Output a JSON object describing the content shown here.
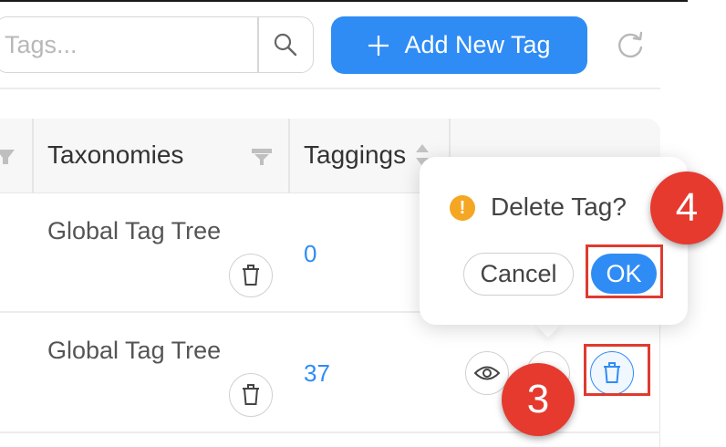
{
  "search": {
    "placeholder": "Tags..."
  },
  "toolbar": {
    "add_label": "Add New Tag"
  },
  "table": {
    "headers": {
      "taxonomies": "Taxonomies",
      "taggings": "Taggings"
    },
    "rows": [
      {
        "taxonomy": "Global Tag Tree",
        "taggings": "0"
      },
      {
        "taxonomy": "Global Tag Tree",
        "taggings": "37"
      }
    ]
  },
  "popconfirm": {
    "title": "Delete Tag?",
    "cancel_label": "Cancel",
    "ok_label": "OK"
  },
  "annotations": {
    "step3": "3",
    "step4": "4"
  },
  "colors": {
    "primary": "#2f8cf5",
    "warning": "#f5a623",
    "highlight": "#e03a2f"
  },
  "icons": [
    "search-icon",
    "plus-icon",
    "refresh-icon",
    "filter-icon",
    "sort-icon",
    "trash-icon",
    "eye-icon",
    "warning-icon"
  ]
}
